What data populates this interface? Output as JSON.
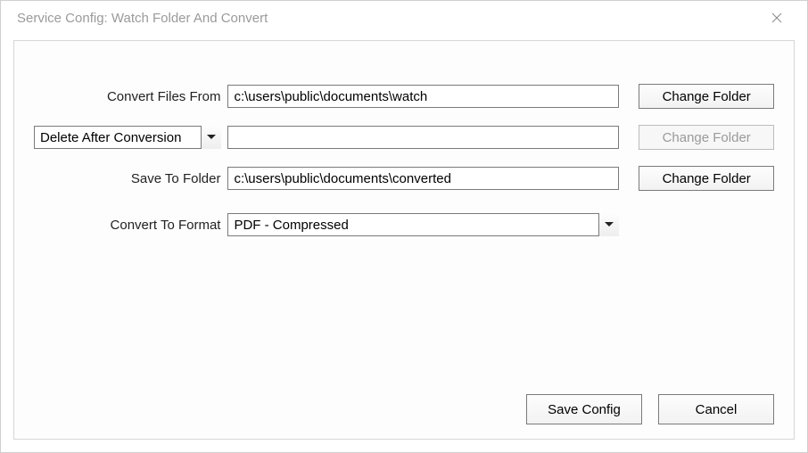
{
  "window": {
    "title": "Service Config: Watch Folder And Convert"
  },
  "labels": {
    "convert_from": "Convert Files From",
    "save_to": "Save To Folder",
    "convert_format": "Convert To Format"
  },
  "inputs": {
    "convert_from_value": "c:\\users\\public\\documents\\watch",
    "after_conversion_dest": "",
    "save_to_value": "c:\\users\\public\\documents\\converted"
  },
  "selects": {
    "after_conversion_selected": "Delete After Conversion",
    "format_selected": "PDF - Compressed"
  },
  "buttons": {
    "change_folder": "Change Folder",
    "save_config": "Save Config",
    "cancel": "Cancel"
  }
}
